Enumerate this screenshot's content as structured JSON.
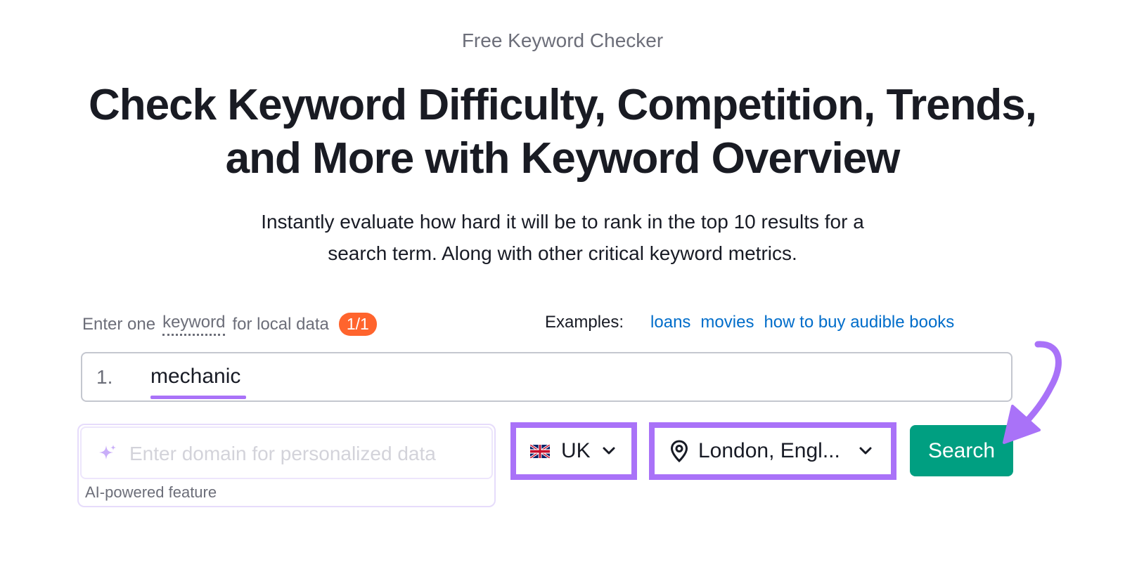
{
  "header": {
    "eyebrow": "Free Keyword Checker",
    "title_line1": "Check Keyword Difficulty, Competition, Trends,",
    "title_line2": "and More with Keyword Overview",
    "subtitle_line1": "Instantly evaluate how hard it will be to rank in the top 10 results for a",
    "subtitle_line2": "search term. Along with other critical keyword metrics."
  },
  "keyword_section": {
    "label_prefix": "Enter one",
    "label_keyword": "keyword",
    "label_suffix": "for local data",
    "count_badge": "1/1",
    "examples_label": "Examples:",
    "examples": [
      "loans",
      "movies",
      "how to buy audible books"
    ],
    "row_number": "1.",
    "keyword_value": "mechanic"
  },
  "domain_section": {
    "placeholder": "Enter domain for personalized data",
    "caption": "AI-powered feature"
  },
  "controls": {
    "country": "UK",
    "location": "London, Engl...",
    "search_label": "Search"
  },
  "colors": {
    "accent_purple": "#a972f8",
    "search_green": "#009f81",
    "badge_orange": "#ff642d",
    "link_blue": "#006dca"
  }
}
